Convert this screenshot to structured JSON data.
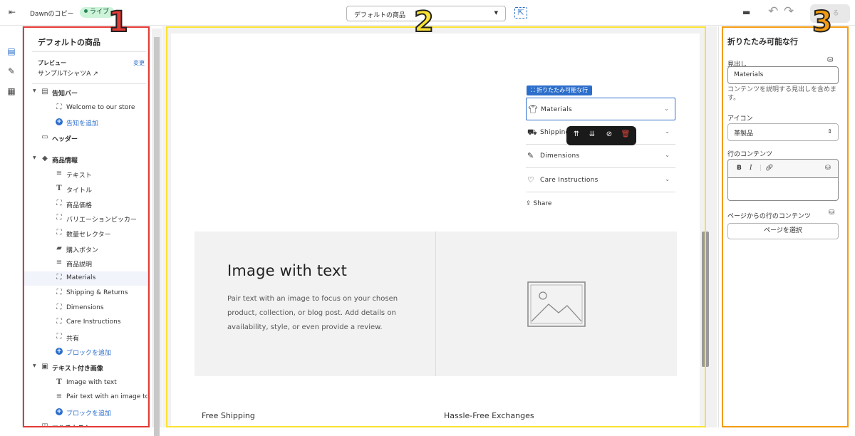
{
  "topbar": {
    "theme_name": "Dawnのコピー",
    "live_label": "ライブ",
    "template_select": "デフォルトの商品",
    "save_label": "る"
  },
  "sidebar": {
    "title": "デフォルトの商品",
    "preview_label": "プレビュー",
    "preview_change": "変更",
    "preview_product": "サンプルTシャツA",
    "tree": [
      {
        "label": "告知バー",
        "icon": "announcement-icon",
        "bold": true,
        "expandable": true
      },
      {
        "label": "Welcome to our store",
        "icon": "block-icon"
      },
      {
        "label": "告知を追加",
        "icon": "add-icon",
        "link": true
      },
      {
        "label": "ヘッダー",
        "icon": "header-icon",
        "bold": true
      },
      {
        "label": "商品情報",
        "icon": "tag-icon",
        "bold": true,
        "expandable": true
      },
      {
        "label": "テキスト",
        "icon": "text-lines-icon"
      },
      {
        "label": "タイトル",
        "icon": "title-icon"
      },
      {
        "label": "商品価格",
        "icon": "block-icon"
      },
      {
        "label": "バリエーションピッカー",
        "icon": "block-icon"
      },
      {
        "label": "数量セレクター",
        "icon": "block-icon"
      },
      {
        "label": "購入ボタン",
        "icon": "buy-button-icon"
      },
      {
        "label": "商品説明",
        "icon": "text-lines-icon"
      },
      {
        "label": "Materials",
        "icon": "block-icon",
        "selected": true
      },
      {
        "label": "Shipping & Returns",
        "icon": "block-icon"
      },
      {
        "label": "Dimensions",
        "icon": "block-icon"
      },
      {
        "label": "Care Instructions",
        "icon": "block-icon"
      },
      {
        "label": "共有",
        "icon": "block-icon"
      },
      {
        "label": "ブロックを追加",
        "icon": "add-icon",
        "link": true
      },
      {
        "label": "テキスト付き画像",
        "icon": "image-text-icon",
        "bold": true,
        "expandable": true
      },
      {
        "label": "Image with text",
        "icon": "title-icon"
      },
      {
        "label": "Pair text with an image to ...",
        "icon": "text-lines-icon"
      },
      {
        "label": "ブロックを追加",
        "icon": "add-icon",
        "link": true
      },
      {
        "label": "マルチカラム",
        "icon": "columns-icon",
        "bold": true
      }
    ]
  },
  "canvas": {
    "block_badge": "折りたたみ可能な行",
    "accordion": [
      {
        "label": "Materials",
        "icon": "shirt-icon"
      },
      {
        "label": "Shipping",
        "icon": "truck-icon"
      },
      {
        "label": "Dimensions",
        "icon": "ruler-icon"
      },
      {
        "label": "Care Instructions",
        "icon": "heart-icon"
      }
    ],
    "share_label": "Share",
    "image_with_text": {
      "heading": "Image with text",
      "body": "Pair text with an image to focus on your chosen product, collection, or blog post. Add details on availability, style, or even provide a review."
    },
    "footer_left": "Free Shipping",
    "footer_right": "Hassle-Free Exchanges"
  },
  "right_panel": {
    "title": "折りたたみ可能な行",
    "heading_label": "見出し",
    "heading_value": "Materials",
    "heading_help": "コンテンツを説明する見出しを含めます。",
    "icon_label": "アイコン",
    "icon_value": "革製品",
    "row_content_label": "行のコンテンツ",
    "page_content_label": "ページからの行のコンテンツ",
    "select_page_button": "ページを選択"
  },
  "annotations": {
    "colors": {
      "box1": "#e53935",
      "box2": "#fbe232",
      "box3": "#f39c12"
    },
    "labels": [
      "1",
      "2",
      "3"
    ]
  }
}
